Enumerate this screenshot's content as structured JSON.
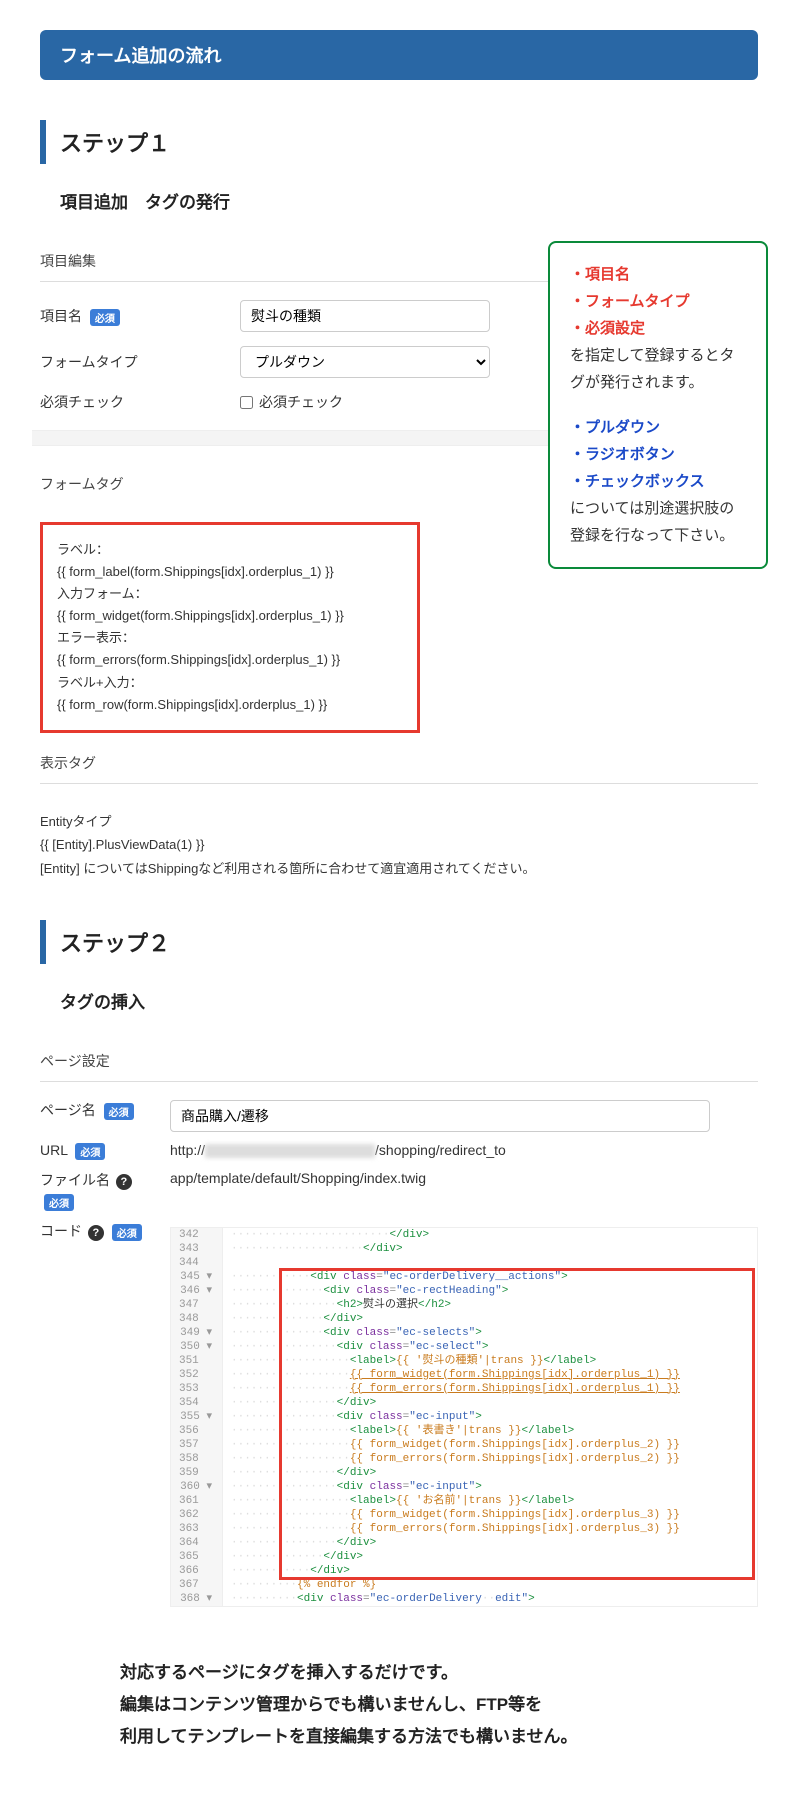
{
  "main_title": "フォーム追加の流れ",
  "step1": {
    "heading": "ステップ１",
    "sub_heading": "項目追加　タグの発行",
    "section_edit": "項目編集",
    "field_name_label": "項目名",
    "field_name_value": "熨斗の種類",
    "form_type_label": "フォームタイプ",
    "form_type_value": "プルダウン",
    "required_label": "必須チェック",
    "required_checkbox_label": "必須チェック",
    "required_badge": "必須",
    "section_formtag": "フォームタグ",
    "formtag_lines": [
      "ラベル：",
      "{{ form_label(form.Shippings[idx].orderplus_1) }}",
      "入力フォーム：",
      "{{ form_widget(form.Shippings[idx].orderplus_1) }}",
      "エラー表示：",
      "{{ form_errors(form.Shippings[idx].orderplus_1) }}",
      "ラベル+入力：",
      "{{ form_row(form.Shippings[idx].orderplus_1) }}"
    ],
    "section_viewtag": "表示タグ",
    "entity_lines": [
      "Entityタイプ",
      "{{ [Entity].PlusViewData(1) }}",
      "[Entity] についてはShippingなど利用される箇所に合わせて適宜適用されてください。"
    ],
    "info": {
      "l1": "・項目名",
      "l2": "・フォームタイプ",
      "l3": "・必須設定",
      "l4": "を指定して登録するとタグが発行されます。",
      "l5": "・プルダウン",
      "l6": "・ラジオボタン",
      "l7": "・チェックボックス",
      "l8": "については別途選択肢の登録を行なって下さい。"
    }
  },
  "step2": {
    "heading": "ステップ２",
    "sub_heading": "タグの挿入",
    "section_page": "ページ設定",
    "page_name_label": "ページ名",
    "page_name_value": "商品購入/遷移",
    "url_label": "URL",
    "url_prefix": "http://",
    "url_suffix": "/shopping/redirect_to",
    "file_label": "ファイル名",
    "file_value": "app/template/default/Shopping/index.twig",
    "code_label": "コード",
    "required_badge": "必須"
  },
  "code_lines": [
    {
      "n": "342",
      "html": "                        <span class='c-tag'>&lt;/div&gt;</span>"
    },
    {
      "n": "343",
      "html": "                    <span class='c-tag'>&lt;/div&gt;</span>"
    },
    {
      "n": "344",
      "html": ""
    },
    {
      "n": "345",
      "fold": true,
      "html": "            <span class='c-tag'>&lt;div</span> <span class='c-attr'>class</span>=<span class='c-val'>\"ec-orderDelivery__actions\"</span><span class='c-tag'>&gt;</span>"
    },
    {
      "n": "346",
      "fold": true,
      "html": "              <span class='c-tag'>&lt;div</span> <span class='c-attr'>class</span>=<span class='c-val'>\"ec-rectHeading\"</span><span class='c-tag'>&gt;</span>"
    },
    {
      "n": "347",
      "html": "                <span class='c-tag'>&lt;h2&gt;</span><span class='c-txt'>熨斗の選択</span><span class='c-tag'>&lt;/h2&gt;</span>"
    },
    {
      "n": "348",
      "html": "              <span class='c-tag'>&lt;/div&gt;</span>"
    },
    {
      "n": "349",
      "fold": true,
      "html": "              <span class='c-tag'>&lt;div</span> <span class='c-attr'>class</span>=<span class='c-val'>\"ec-selects\"</span><span class='c-tag'>&gt;</span>"
    },
    {
      "n": "350",
      "fold": true,
      "html": "                <span class='c-tag'>&lt;div</span> <span class='c-attr'>class</span>=<span class='c-val'>\"ec-select\"</span><span class='c-tag'>&gt;</span>"
    },
    {
      "n": "351",
      "html": "                  <span class='c-tag'>&lt;label&gt;</span><span class='c-tw'>{{ '熨斗の種類'|trans }}</span><span class='c-tag'>&lt;/label&gt;</span>"
    },
    {
      "n": "352",
      "html": "                  <span class='c-tw c-u'>{{ form_widget(form.Shippings[idx].orderplus_1) }}</span>"
    },
    {
      "n": "353",
      "html": "                  <span class='c-tw c-u'>{{ form_errors(form.Shippings[idx].orderplus_1) }}</span>"
    },
    {
      "n": "354",
      "html": "                <span class='c-tag'>&lt;/div&gt;</span>"
    },
    {
      "n": "355",
      "fold": true,
      "html": "                <span class='c-tag'>&lt;div</span> <span class='c-attr'>class</span>=<span class='c-val'>\"ec-input\"</span><span class='c-tag'>&gt;</span>"
    },
    {
      "n": "356",
      "html": "                  <span class='c-tag'>&lt;label&gt;</span><span class='c-tw'>{{ '表書き'|trans }}</span><span class='c-tag'>&lt;/label&gt;</span>"
    },
    {
      "n": "357",
      "html": "                  <span class='c-tw'>{{ form_widget(form.Shippings[idx].orderplus_2) }}</span>"
    },
    {
      "n": "358",
      "html": "                  <span class='c-tw'>{{ form_errors(form.Shippings[idx].orderplus_2) }}</span>"
    },
    {
      "n": "359",
      "html": "                <span class='c-tag'>&lt;/div&gt;</span>"
    },
    {
      "n": "360",
      "fold": true,
      "html": "                <span class='c-tag'>&lt;div</span> <span class='c-attr'>class</span>=<span class='c-val'>\"ec-input\"</span><span class='c-tag'>&gt;</span>"
    },
    {
      "n": "361",
      "html": "                  <span class='c-tag'>&lt;label&gt;</span><span class='c-tw'>{{ 'お名前'|trans }}</span><span class='c-tag'>&lt;/label&gt;</span>"
    },
    {
      "n": "362",
      "html": "                  <span class='c-tw'>{{ form_widget(form.Shippings[idx].orderplus_3) }}</span>"
    },
    {
      "n": "363",
      "html": "                  <span class='c-tw'>{{ form_errors(form.Shippings[idx].orderplus_3) }}</span>"
    },
    {
      "n": "364",
      "html": "                <span class='c-tag'>&lt;/div&gt;</span>"
    },
    {
      "n": "365",
      "html": "              <span class='c-tag'>&lt;/div&gt;</span>"
    },
    {
      "n": "366",
      "html": "            <span class='c-tag'>&lt;/div&gt;</span>"
    },
    {
      "n": "367",
      "html": "          <span class='c-tw'>{% endfor %}</span>"
    },
    {
      "n": "368",
      "fold": true,
      "html": "          <span class='c-tag'>&lt;div</span> <span class='c-attr'>class</span>=<span class='c-val'>\"ec-orderDelivery  edit\"</span><span class='c-tag'>&gt;</span>"
    }
  ],
  "footer": {
    "l1": "対応するページにタグを挿入するだけです。",
    "l2": "編集はコンテンツ管理からでも構いませんし、FTP等を",
    "l3": "利用してテンプレートを直接編集する方法でも構いません。"
  }
}
